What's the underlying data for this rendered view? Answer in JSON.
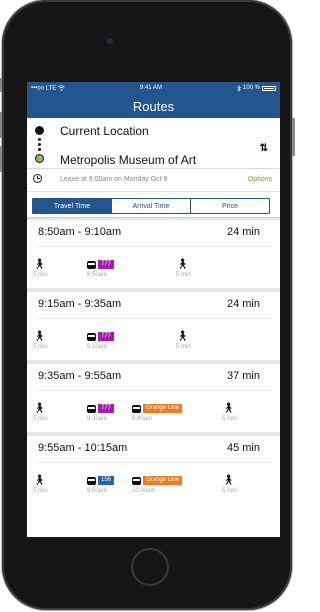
{
  "colors": {
    "nav": "#23558f",
    "accent_green": "#6aaa3a",
    "line_777": "#a21caf",
    "line_orange": "#ef7d1f",
    "line_156": "#2462b0"
  },
  "status_bar": {
    "carrier": "•••oo LTE",
    "wifi_icon": "wifi-icon",
    "time": "9:41 AM",
    "bluetooth_icon": "bluetooth-icon",
    "battery": "100 %"
  },
  "navbar": {
    "title": "Routes"
  },
  "locations": {
    "from": "Current Location",
    "to": "Metropolis Museum of Art",
    "swap_icon": "swap-icon"
  },
  "leave": {
    "text": "Leave at 9:00am on Monday Oct 9",
    "options": "Options"
  },
  "tabs": [
    {
      "label": "Travel Time",
      "active": true
    },
    {
      "label": "Arrival Time",
      "active": false
    },
    {
      "label": "Price",
      "active": false
    }
  ],
  "routes": [
    {
      "time": "8:50am - 9:10am",
      "duration": "24 min",
      "legs": [
        {
          "type": "walk",
          "sub": "5 min"
        },
        {
          "type": "bus",
          "badges": [
            {
              "label": "777",
              "color": "#a21caf"
            }
          ],
          "sub": "8:50am"
        },
        {
          "type": "walk",
          "sub": "5 min"
        }
      ]
    },
    {
      "time": "9:15am - 9:35am",
      "duration": "24 min",
      "legs": [
        {
          "type": "walk",
          "sub": "5 min"
        },
        {
          "type": "bus",
          "badges": [
            {
              "label": "777",
              "color": "#a21caf"
            }
          ],
          "sub": "9:10am"
        },
        {
          "type": "walk",
          "sub": "5 min"
        }
      ]
    },
    {
      "time": "9:35am - 9:55am",
      "duration": "37 min",
      "legs": [
        {
          "type": "walk",
          "sub": "5 min"
        },
        {
          "type": "bus",
          "badges": [
            {
              "label": "777",
              "color": "#a21caf"
            }
          ],
          "sub": "9:30am"
        },
        {
          "type": "train",
          "badges": [
            {
              "label": "Orange Line",
              "color": "#ef7d1f"
            }
          ],
          "sub": "9:40am"
        },
        {
          "type": "walk",
          "sub": "5 min"
        }
      ]
    },
    {
      "time": "9:55am - 10:15am",
      "duration": "45 min",
      "legs": [
        {
          "type": "walk",
          "sub": "5 min"
        },
        {
          "type": "bus",
          "badges": [
            {
              "label": "156",
              "color": "#2462b0"
            }
          ],
          "sub": "9:50am"
        },
        {
          "type": "train",
          "badges": [
            {
              "label": "Orange Line",
              "color": "#ef7d1f"
            }
          ],
          "sub": "10:00am"
        },
        {
          "type": "walk",
          "sub": "5 min"
        }
      ]
    }
  ]
}
